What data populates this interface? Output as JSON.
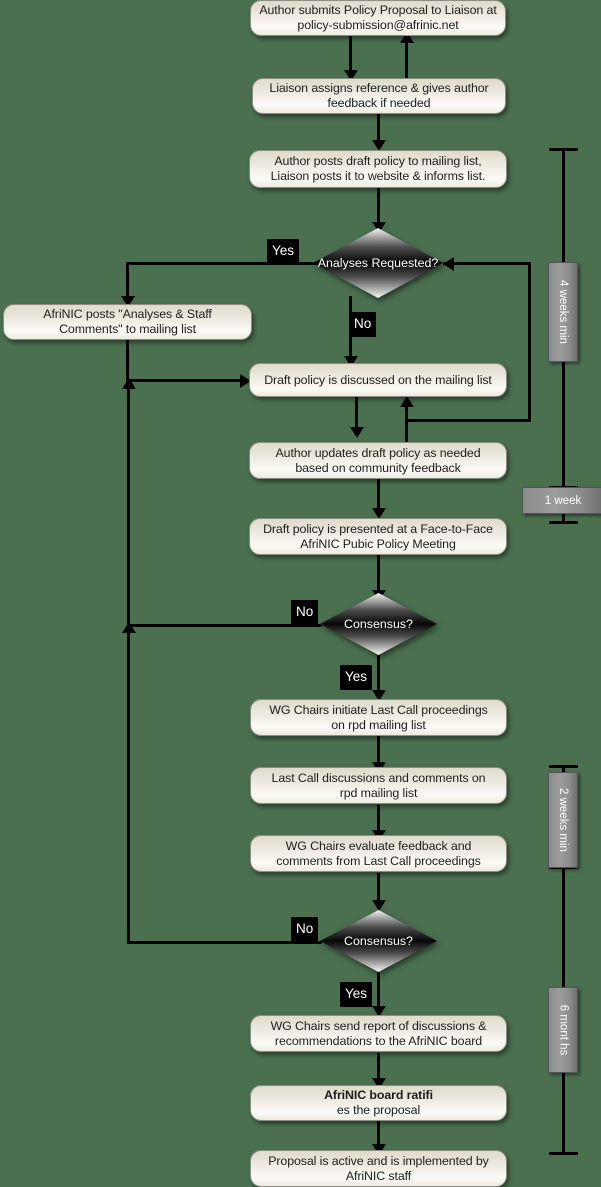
{
  "diagram": {
    "title": "AfriNIC Policy Development Process flowchart",
    "background_color": "#4a7050",
    "box_fill": "#f2f0e8",
    "diamond_fill_dark": "#000000",
    "diamond_fill_light": "#ffffff",
    "chip_background": "#000000",
    "chip_text_color": "#ffffff",
    "duration_label_color": "#8b8b8b"
  },
  "nodes": {
    "submit": {
      "line1": "Author submits Policy Proposal to Liaison at",
      "line2": "policy-submission@afrinic.net"
    },
    "liaison": {
      "line1": "Liaison assigns reference & gives author",
      "line2": "feedback if needed"
    },
    "post_draft": {
      "line1": "Author posts draft policy to mailing list,",
      "line2": "Liaison posts it to website & informs list."
    },
    "analyses_decision": {
      "line1": "Analyses",
      "line2": "Requested?"
    },
    "afrinic_posts": {
      "line1": "AfriNIC posts \"Analyses & Staff",
      "line2": "Comments\" to mailing list"
    },
    "discussed": {
      "line1": "Draft policy is discussed on the mailing list",
      "line2": ""
    },
    "updates": {
      "line1": "Author updates draft policy as needed",
      "line2": "based on community feedback"
    },
    "face_to_face": {
      "line1": "Draft policy is presented at a Face-to-Face",
      "line2": "AfriNIC Pubic Policy Meeting"
    },
    "consensus1": {
      "line1": "Consensus?",
      "line2": ""
    },
    "last_call_init": {
      "line1": "WG Chairs initiate Last Call proceedings",
      "line2": "on rpd mailing list"
    },
    "last_call_disc": {
      "line1": "Last Call discussions and comments on",
      "line2": "rpd mailing list"
    },
    "evaluate": {
      "line1": "WG Chairs evaluate feedback and",
      "line2": "comments from Last Call proceedings"
    },
    "consensus2": {
      "line1": "Consensus?",
      "line2": ""
    },
    "send_report": {
      "line1": "WG Chairs send report of discussions &",
      "line2": "recommendations to the AfriNIC board"
    },
    "ratifies": {
      "bold_part": "AfriNIC board ratifi",
      "rest_part": "es the proposal"
    },
    "active": {
      "line1": "Proposal is active and is implemented by",
      "line2": "AfriNIC staff"
    }
  },
  "branch_labels": {
    "analyses_yes": "Yes",
    "analyses_no": "No",
    "consensus1_no": "No",
    "consensus1_yes": "Yes",
    "consensus2_no": "No",
    "consensus2_yes": "Yes"
  },
  "durations": [
    {
      "id": "four-weeks-min",
      "text": "4 weeks min",
      "orientation": "vertical"
    },
    {
      "id": "one-week",
      "text": "1 week",
      "orientation": "horizontal"
    },
    {
      "id": "two-weeks-min",
      "text": "2 weeks min",
      "orientation": "vertical"
    },
    {
      "id": "six-months",
      "text": "6 mont hs",
      "orientation": "vertical"
    }
  ]
}
